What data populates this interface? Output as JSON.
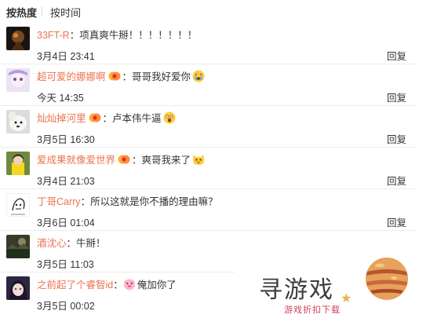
{
  "sort": {
    "hot": "按热度",
    "time": "按时间"
  },
  "comments": [
    {
      "user": "33FT-R",
      "colon": "：",
      "text": "项真爽牛掰！！！！！！！",
      "date": "3月4日 23:41",
      "reply": "回复",
      "badge": false,
      "emoji": ""
    },
    {
      "user": "超可爱的娜娜啊",
      "colon": "",
      "text": "：哥哥我好爱你",
      "date": "今天 14:35",
      "reply": "回复",
      "badge": true,
      "emoji": "crying-face"
    },
    {
      "user": "灿灿掉河里",
      "colon": "",
      "text": "：卢本伟牛逼",
      "date": "3月5日 16:30",
      "reply": "回复",
      "badge": true,
      "emoji": "shocked-face"
    },
    {
      "user": "爱成果就像爱世界",
      "colon": "",
      "text": "：爽哥我来了",
      "date": "3月4日 21:03",
      "reply": "回复",
      "badge": true,
      "emoji": "cat-face"
    },
    {
      "user": "丁哥Carry",
      "colon": "：",
      "text": "所以这就是你不播的理由嘛？",
      "date": "3月6日 01:04",
      "reply": "回复",
      "badge": false,
      "emoji": ""
    },
    {
      "user": "酒沈心",
      "colon": "：",
      "text": "牛掰！",
      "date": "3月5日 11:03",
      "reply": "回复",
      "badge": false,
      "emoji": ""
    },
    {
      "user": "之前起了个睿智id",
      "colon": "：",
      "text": "俺加你了",
      "date": "3月5日 00:02",
      "reply": "回复",
      "badge": false,
      "emoji": "pig-face"
    }
  ],
  "watermark": {
    "title": "寻游戏",
    "subtitle": "游戏折扣下载"
  },
  "colors": {
    "username": "#eb7350",
    "text": "#333333",
    "divider": "#ececec"
  }
}
